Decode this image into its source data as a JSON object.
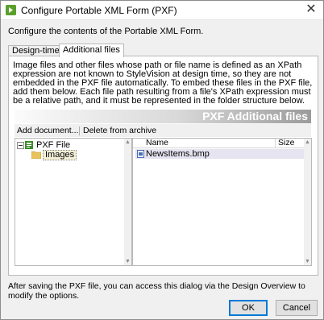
{
  "window": {
    "title": "Configure Portable XML Form (PXF)",
    "close_glyph": "✕"
  },
  "intro": "Configure the contents of the Portable XML Form.",
  "tabs": [
    {
      "label": "Design-time files",
      "selected": false
    },
    {
      "label": "Additional files",
      "selected": true
    }
  ],
  "panel": {
    "description": "Image files and other files whose path or file name is defined as an XPath expression are not known to StyleVision at design time, so they are not embedded in the PXF file automatically. To embed these files in the PXF file, add them below. Each file path resulting from a file's XPath expression must be a relative path, and it must be represented in the folder structure below.",
    "banner_title": "PXF Additional files",
    "toolbar": {
      "add_label": "Add document...",
      "delete_label": "Delete from archive"
    },
    "tree": {
      "root_label": "PXF File",
      "child_label": "Images"
    },
    "files": {
      "columns": [
        "Name",
        "Size"
      ],
      "rows": [
        {
          "name": "NewsItems.bmp",
          "size": ""
        }
      ]
    }
  },
  "footer_text": "After saving the PXF file, you can access this dialog via the Design Overview to modify the options.",
  "buttons": {
    "ok": "OK",
    "cancel": "Cancel"
  },
  "icons": {
    "app": "altova-stylevision-icon",
    "pxf": "pxf-file-icon",
    "folder": "folder-icon",
    "file": "bitmap-file-icon"
  },
  "colors": {
    "app_icon": "#5aa02c",
    "banner_text": "#ffffff",
    "selected_row": "#e6e4f0",
    "ok_border": "#0078d7"
  }
}
